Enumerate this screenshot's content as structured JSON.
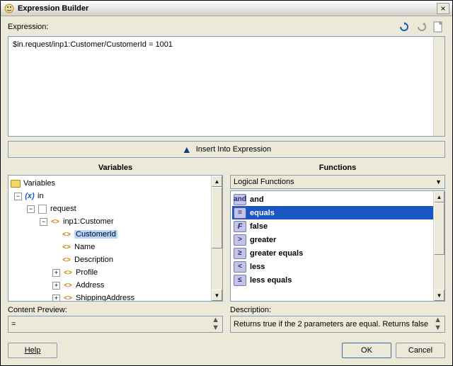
{
  "window": {
    "title": "Expression Builder"
  },
  "labels": {
    "expression": "Expression:",
    "insert": "Insert Into Expression",
    "variables": "Variables",
    "functions": "Functions",
    "contentPreview": "Content Preview:",
    "description": "Description:",
    "help": "Help",
    "ok": "OK",
    "cancel": "Cancel"
  },
  "expression": "$in.request/inp1:Customer/CustomerId = 1001",
  "tree": {
    "root": "Variables",
    "in": "in",
    "request": "request",
    "customer": "inp1:Customer",
    "customerId": "CustomerId",
    "name": "Name",
    "description": "Description",
    "profile": "Profile",
    "address": "Address",
    "shippingAddress": "ShippingAddress"
  },
  "funcCombo": "Logical Functions",
  "funcs": {
    "and": "and",
    "equals": "equals",
    "false": "false",
    "greater": "greater",
    "greaterEquals": "greater equals",
    "less": "less",
    "lessEquals": "less equals"
  },
  "contentPreview": "=",
  "descriptionText": "Returns true if the 2 parameters are equal. Returns false"
}
